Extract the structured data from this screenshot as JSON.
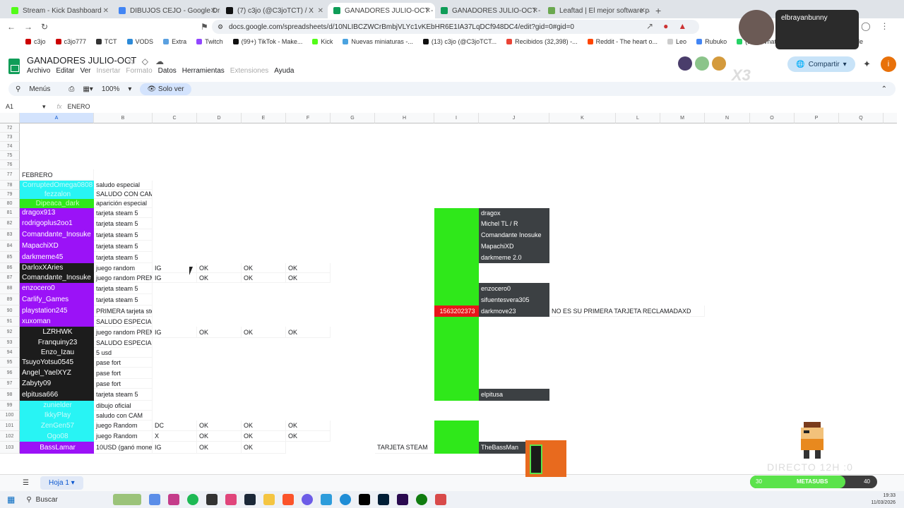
{
  "browser": {
    "tabs": [
      {
        "label": "Stream - Kick Dashboard",
        "color": "#53fc18"
      },
      {
        "label": "DIBUJOS CEJO - Google Drive",
        "color": "#4285f4"
      },
      {
        "label": "(7) c3jo (@C3joTCT) / X",
        "color": "#111111"
      },
      {
        "label": "GANADORES JULIO-OCT - Hoja...",
        "color": "#0f9d58",
        "active": true
      },
      {
        "label": "GANADORES JULIO-OCT - Hojas de...",
        "color": "#0f9d58"
      },
      {
        "label": "Leaftad | El mejor software para pos...",
        "color": "#6aa84f"
      }
    ],
    "url": "docs.google.com/spreadsheets/d/10NLIBCZWCrBmbjVLYc1vKEbHR6E1IA37LqDCf948DC4/edit?gid=0#gid=0",
    "bookmarks": [
      "c3jo",
      "c3jo777",
      "TCT",
      "VODS",
      "Extra",
      "Twitch",
      "(99+) TikTok - Make...",
      "Kick",
      "Nuevas miniaturas -...",
      "(13) c3jo (@C3joTCT...",
      "Recibidos (32,398) -...",
      "Reddit - The heart o...",
      "Leo",
      "Rubuko",
      "(118) WhatsApp",
      "Buscar con Google"
    ]
  },
  "doc": {
    "title": "GANADORES JULIO-OCT",
    "menus": [
      "Archivo",
      "Editar",
      "Ver",
      "Insertar",
      "Formato",
      "Datos",
      "Herramientas",
      "Extensiones",
      "Ayuda"
    ],
    "disabled_menus": [
      "Insertar",
      "Formato",
      "Extensiones"
    ],
    "share_label": "Compartir",
    "avatar_letter": "i"
  },
  "toolbar": {
    "menus_label": "Menús",
    "zoom": "100%",
    "view_only": "Solo ver"
  },
  "formula": {
    "cell_ref": "A1",
    "fx": "fx",
    "value": "ENERO"
  },
  "columns": [
    "A",
    "B",
    "C",
    "D",
    "E",
    "F",
    "G",
    "H",
    "I",
    "J",
    "K",
    "L",
    "M",
    "N",
    "O",
    "P",
    "Q",
    "R"
  ],
  "rows": [
    "72",
    "73",
    "74",
    "75",
    "76",
    "77",
    "78",
    "79",
    "80",
    "81",
    "82",
    "83",
    "84",
    "85",
    "86",
    "87",
    "88",
    "89",
    "90",
    "91",
    "92",
    "93",
    "94",
    "95",
    "96",
    "97",
    "98",
    "99",
    "100",
    "101",
    "102",
    "103"
  ],
  "cells": {
    "a77": "FEBRERO",
    "a78": "CorruptedOmega0808",
    "b78": "saludo especial",
    "a79": "fezzalon",
    "b79": "SALUDO CON CAM",
    "a80": "Dipeaca_dark",
    "b80": "aparición especial",
    "a81": "dragox913",
    "b81": "tarjeta steam 5",
    "a82": "rodrigoplus2oo1",
    "b82": "tarjeta steam 5",
    "a83": "Comandante_Inosuke",
    "b83": "tarjeta steam 5",
    "a84": "MapachiXD",
    "b84": "tarjeta steam 5",
    "a85": "darkmeme45",
    "b85": "tarjeta steam 5",
    "a86": "DarloxXAries",
    "b86": "juego random",
    "c86": "IG",
    "d86": "OK",
    "e86": "OK",
    "f86": "OK",
    "a87": "Comandante_Inosuke",
    "b87": "juego random PREMIUM",
    "c87": "IG",
    "d87": "OK",
    "e87": "OK",
    "f87": "OK",
    "a88": "enzocero0",
    "b88": "tarjeta steam 5",
    "a89": "Carlify_Games",
    "b89": "tarjeta steam 5",
    "a90": "playstation245",
    "b90": "PRIMERA tarjeta steam 5",
    "a91": "xuxoman",
    "b91": "SALUDO ESPECIAL",
    "a92": "LZRHWK",
    "b92": "juego random PREMIUM",
    "c92": "IG",
    "d92": "OK",
    "e92": "OK",
    "f92": "OK",
    "a93": "Franquiny23",
    "b93": "SALUDO ESPECIAL",
    "a94": "Enzo_Izau",
    "b94": "5 usd",
    "a95": "TsuyoYotsu0545",
    "b95": "pase fort",
    "a96": "Angel_YaelXYZ",
    "b96": "pase fort",
    "a97": "Zabyty09",
    "b97": "pase fort",
    "a98": "elpitusa666",
    "b98": "tarjeta steam 5",
    "a99": "zunielder",
    "b99": "dibujo oficial",
    "a100": "IkkyPlay",
    "b100": "saludo con CAM",
    "a101": "ZenGen57",
    "b101": "juego Random",
    "c101": "DC",
    "d101": "OK",
    "e101": "OK",
    "f101": "OK",
    "a102": "Ogo08",
    "b102": "juego Random",
    "c102": "X",
    "d102": "OK",
    "e102": "OK",
    "f102": "OK",
    "a103": "BassLamar",
    "b103": "10USD (ganó moneda)",
    "c103": "IG",
    "d103": "OK",
    "e103": "OK",
    "h103": "TARJETA STEAM",
    "j81": "dragox",
    "j82": "Michel TL / R",
    "j83": "Comandante Inosuke",
    "j84": "MapachiXD",
    "j85": "darkmeme 2.0",
    "j88": "enzocero0",
    "j89": "sifuentesvera305",
    "i90": "1563202373",
    "j90": "darkmove23",
    "k90": "NO ES SU PRIMERA TARJETA RECLAMADAXD",
    "j98": "elpitusa",
    "j103": "TheBassMan"
  },
  "bottom": {
    "sheet_tab": "Hoja 1"
  },
  "taskbar": {
    "search": "Buscar",
    "time": "19:33",
    "date": "11/03/2026"
  },
  "stream": {
    "username": "elbrayanbunny",
    "multiplier": "X3",
    "directo": "DIRECTO 12H :0",
    "meta_label": "METASUBS",
    "meta_current": "30",
    "meta_goal": "40",
    "meta_progress": 0.75
  }
}
